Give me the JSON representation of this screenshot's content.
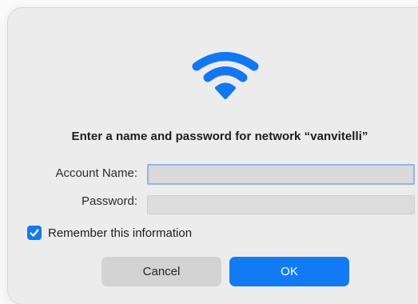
{
  "dialog": {
    "icon": "wifi-icon",
    "title": "Enter a name and password for network “vanvitelli”",
    "accent_color": "#127bf4",
    "fields": {
      "account_label": "Account Name:",
      "account_value": "",
      "password_label": "Password:",
      "password_value": ""
    },
    "remember": {
      "label": "Remember this information",
      "checked": true
    },
    "buttons": {
      "cancel": "Cancel",
      "ok": "OK"
    }
  }
}
